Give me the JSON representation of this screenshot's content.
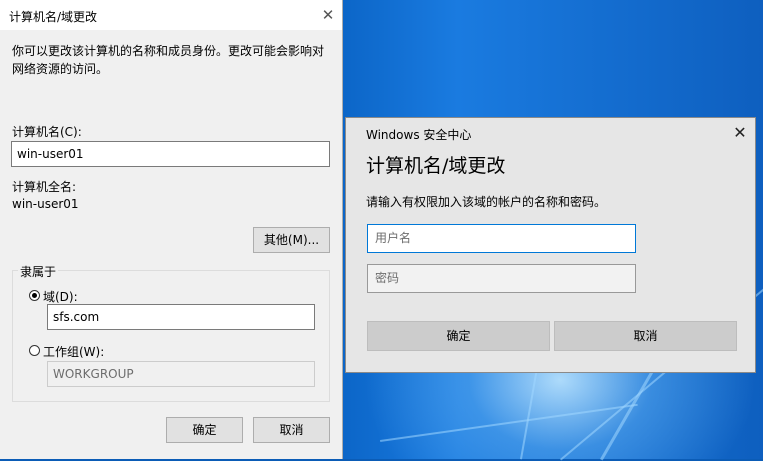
{
  "dialog1": {
    "title": "计算机名/域更改",
    "description": "你可以更改该计算机的名称和成员身份。更改可能会影响对网络资源的访问。",
    "computer_name_label": "计算机名(C):",
    "computer_name_value": "win-user01",
    "full_name_label": "计算机全名:",
    "full_name_value": "win-user01",
    "more_button": "其他(M)...",
    "member_of_label": "隶属于",
    "domain_radio_label": "域(D):",
    "domain_value": "sfs.com",
    "domain_selected": true,
    "workgroup_radio_label": "工作组(W):",
    "workgroup_value": "WORKGROUP",
    "ok_button": "确定",
    "cancel_button": "取消"
  },
  "dialog2": {
    "app_title": "Windows 安全中心",
    "heading": "计算机名/域更改",
    "description": "请输入有权限加入该域的帐户的名称和密码。",
    "username_placeholder": "用户名",
    "password_placeholder": "密码",
    "ok_button": "确定",
    "cancel_button": "取消"
  },
  "colors": {
    "desktop_blue": "#0b5cb6",
    "focus_border": "#0078d7"
  }
}
